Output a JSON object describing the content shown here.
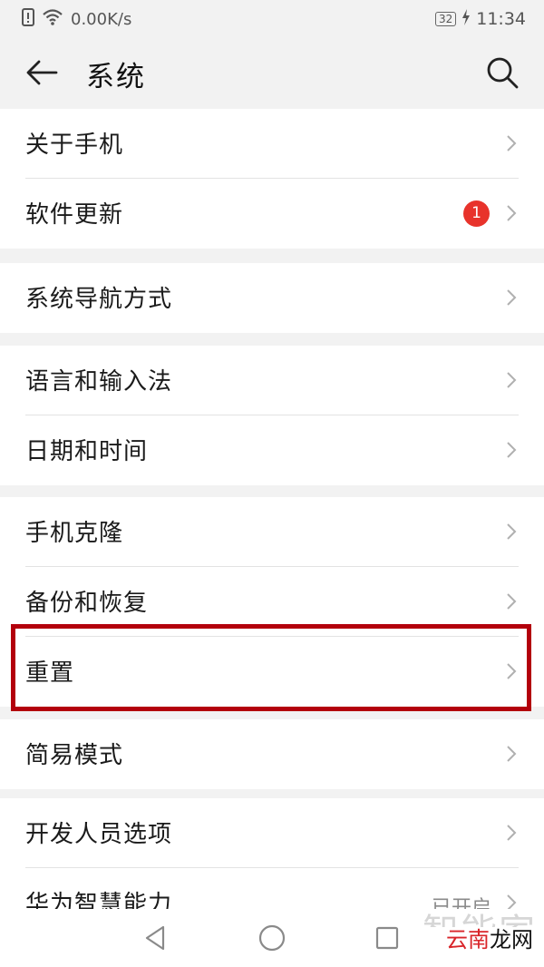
{
  "status_bar": {
    "net_speed": "0.00K/s",
    "battery": "32",
    "time": "11:34",
    "icons": [
      "sim-alert-icon",
      "wifi-icon",
      "battery-icon",
      "charging-icon"
    ]
  },
  "header": {
    "title": "系统",
    "back_icon": "arrow-left-icon",
    "search_icon": "search-icon"
  },
  "groups": [
    {
      "items": [
        {
          "label": "关于手机"
        },
        {
          "label": "软件更新",
          "badge": "1"
        }
      ]
    },
    {
      "items": [
        {
          "label": "系统导航方式"
        }
      ]
    },
    {
      "items": [
        {
          "label": "语言和输入法"
        },
        {
          "label": "日期和时间"
        }
      ]
    },
    {
      "items": [
        {
          "label": "手机克隆"
        },
        {
          "label": "备份和恢复"
        },
        {
          "label": "重置",
          "highlighted": true
        },
        {
          "label": "简易模式"
        }
      ]
    },
    {
      "items": [
        {
          "label": "开发人员选项"
        },
        {
          "label": "华为智慧能力",
          "value": "已开启"
        }
      ]
    }
  ],
  "nav_bar": {
    "icons": [
      "back-triangle-icon",
      "home-circle-icon",
      "recents-square-icon"
    ]
  },
  "watermark": {
    "faint": "智能家",
    "brand_red": "云南",
    "brand_black": "龙网"
  },
  "colors": {
    "background": "#f2f2f2",
    "highlight_border": "#b3000c",
    "badge": "#e8332b"
  }
}
